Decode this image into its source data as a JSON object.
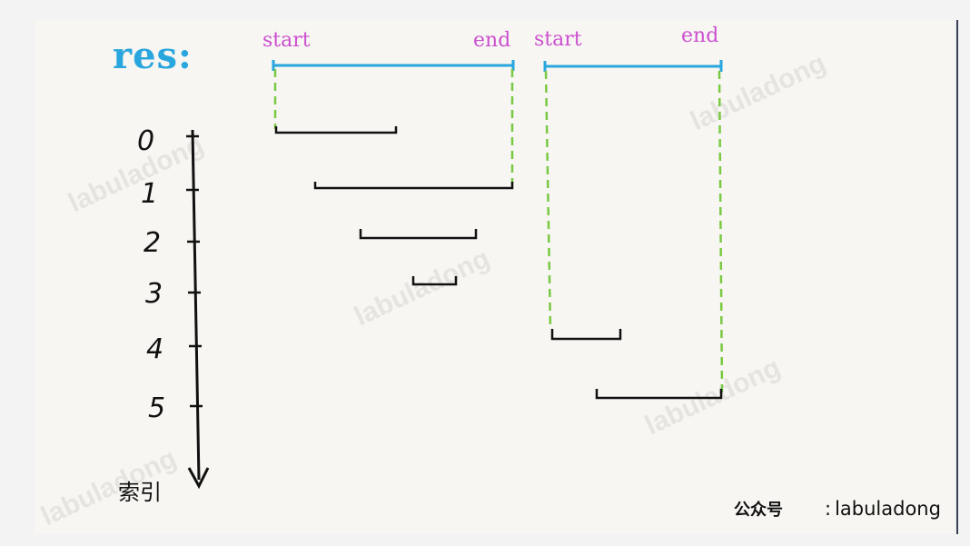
{
  "res_label": "res:",
  "intervals_header": [
    {
      "start": "start",
      "end": "end"
    },
    {
      "start": "start",
      "end": "end"
    }
  ],
  "axis": {
    "ticks": [
      "0",
      "1",
      "2",
      "3",
      "4",
      "5"
    ],
    "label": "索引"
  },
  "watermark": "labuladong",
  "credit": {
    "prefix_seal": "公众号",
    "colon": ":",
    "name": "labuladong"
  },
  "colors": {
    "res": "#2aa6de",
    "tag": "#cc4fcf",
    "merged_line": "#2aa6de",
    "dashed": "#7ac943",
    "interval": "#111111"
  }
}
